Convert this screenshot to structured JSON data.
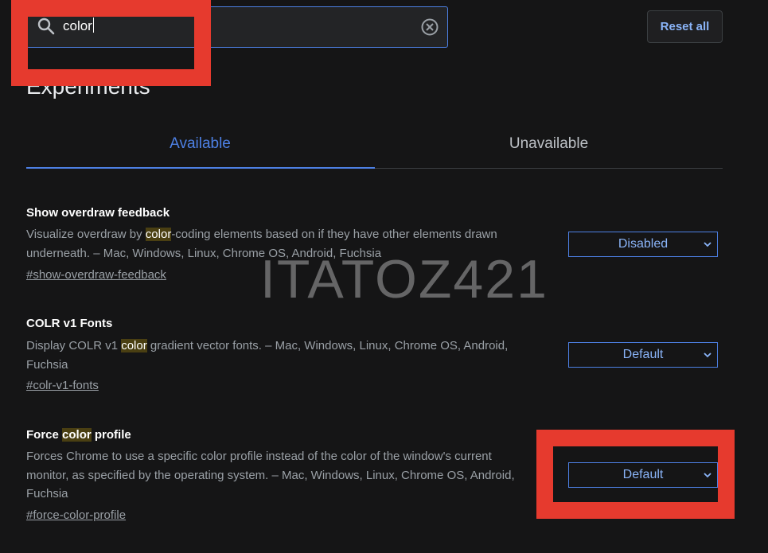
{
  "search": {
    "value": "color",
    "clear_icon": "clear-circle-icon",
    "icon": "search-icon"
  },
  "toolbar": {
    "reset_label": "Reset all"
  },
  "page": {
    "title": "Experiments"
  },
  "tabs": [
    {
      "label": "Available",
      "active": true
    },
    {
      "label": "Unavailable",
      "active": false
    }
  ],
  "experiments": [
    {
      "title": "Show overdraw feedback",
      "desc_before": "Visualize overdraw by ",
      "desc_highlight": "color",
      "desc_after": "-coding elements based on if they have other elements drawn\nunderneath. – Mac, Windows, Linux, Chrome OS, Android, Fuchsia",
      "link": "#show-overdraw-feedback",
      "select_value": "Disabled"
    },
    {
      "title": "COLR v1 Fonts",
      "desc_before": "Display COLR v1 ",
      "desc_highlight": "color",
      "desc_after": " gradient vector fonts. – Mac, Windows, Linux, Chrome OS, Android,\nFuchsia",
      "link": "#colr-v1-fonts",
      "select_value": "Default"
    },
    {
      "title_before": "Force ",
      "title_highlight": "color",
      "title_after": " profile",
      "desc": "Forces Chrome to use a specific color profile instead of the color of the window's current\nmonitor, as specified by the operating system. – Mac, Windows, Linux, Chrome OS, Android,\nFuchsia",
      "link": "#force-color-profile",
      "select_value": "Default"
    }
  ],
  "watermark": "ITATOZ421",
  "colors": {
    "accent": "#4d80e4",
    "link_accent": "#8ab4f8",
    "annotation_red": "#e63a2e",
    "background": "#151516"
  }
}
